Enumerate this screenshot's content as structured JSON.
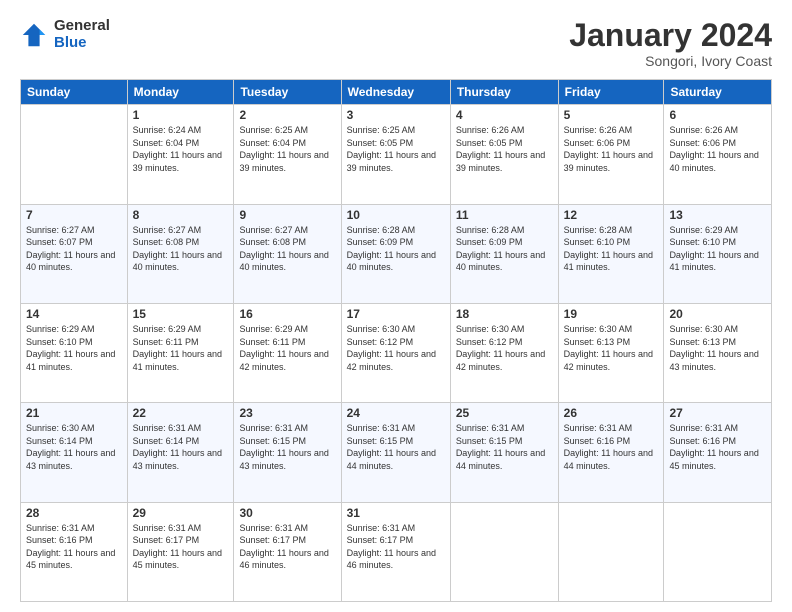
{
  "logo": {
    "general": "General",
    "blue": "Blue"
  },
  "header": {
    "title": "January 2024",
    "subtitle": "Songori, Ivory Coast"
  },
  "columns": [
    "Sunday",
    "Monday",
    "Tuesday",
    "Wednesday",
    "Thursday",
    "Friday",
    "Saturday"
  ],
  "weeks": [
    [
      {
        "day": "",
        "sunrise": "",
        "sunset": "",
        "daylight": ""
      },
      {
        "day": "1",
        "sunrise": "Sunrise: 6:24 AM",
        "sunset": "Sunset: 6:04 PM",
        "daylight": "Daylight: 11 hours and 39 minutes."
      },
      {
        "day": "2",
        "sunrise": "Sunrise: 6:25 AM",
        "sunset": "Sunset: 6:04 PM",
        "daylight": "Daylight: 11 hours and 39 minutes."
      },
      {
        "day": "3",
        "sunrise": "Sunrise: 6:25 AM",
        "sunset": "Sunset: 6:05 PM",
        "daylight": "Daylight: 11 hours and 39 minutes."
      },
      {
        "day": "4",
        "sunrise": "Sunrise: 6:26 AM",
        "sunset": "Sunset: 6:05 PM",
        "daylight": "Daylight: 11 hours and 39 minutes."
      },
      {
        "day": "5",
        "sunrise": "Sunrise: 6:26 AM",
        "sunset": "Sunset: 6:06 PM",
        "daylight": "Daylight: 11 hours and 39 minutes."
      },
      {
        "day": "6",
        "sunrise": "Sunrise: 6:26 AM",
        "sunset": "Sunset: 6:06 PM",
        "daylight": "Daylight: 11 hours and 40 minutes."
      }
    ],
    [
      {
        "day": "7",
        "sunrise": "Sunrise: 6:27 AM",
        "sunset": "Sunset: 6:07 PM",
        "daylight": "Daylight: 11 hours and 40 minutes."
      },
      {
        "day": "8",
        "sunrise": "Sunrise: 6:27 AM",
        "sunset": "Sunset: 6:08 PM",
        "daylight": "Daylight: 11 hours and 40 minutes."
      },
      {
        "day": "9",
        "sunrise": "Sunrise: 6:27 AM",
        "sunset": "Sunset: 6:08 PM",
        "daylight": "Daylight: 11 hours and 40 minutes."
      },
      {
        "day": "10",
        "sunrise": "Sunrise: 6:28 AM",
        "sunset": "Sunset: 6:09 PM",
        "daylight": "Daylight: 11 hours and 40 minutes."
      },
      {
        "day": "11",
        "sunrise": "Sunrise: 6:28 AM",
        "sunset": "Sunset: 6:09 PM",
        "daylight": "Daylight: 11 hours and 40 minutes."
      },
      {
        "day": "12",
        "sunrise": "Sunrise: 6:28 AM",
        "sunset": "Sunset: 6:10 PM",
        "daylight": "Daylight: 11 hours and 41 minutes."
      },
      {
        "day": "13",
        "sunrise": "Sunrise: 6:29 AM",
        "sunset": "Sunset: 6:10 PM",
        "daylight": "Daylight: 11 hours and 41 minutes."
      }
    ],
    [
      {
        "day": "14",
        "sunrise": "Sunrise: 6:29 AM",
        "sunset": "Sunset: 6:10 PM",
        "daylight": "Daylight: 11 hours and 41 minutes."
      },
      {
        "day": "15",
        "sunrise": "Sunrise: 6:29 AM",
        "sunset": "Sunset: 6:11 PM",
        "daylight": "Daylight: 11 hours and 41 minutes."
      },
      {
        "day": "16",
        "sunrise": "Sunrise: 6:29 AM",
        "sunset": "Sunset: 6:11 PM",
        "daylight": "Daylight: 11 hours and 42 minutes."
      },
      {
        "day": "17",
        "sunrise": "Sunrise: 6:30 AM",
        "sunset": "Sunset: 6:12 PM",
        "daylight": "Daylight: 11 hours and 42 minutes."
      },
      {
        "day": "18",
        "sunrise": "Sunrise: 6:30 AM",
        "sunset": "Sunset: 6:12 PM",
        "daylight": "Daylight: 11 hours and 42 minutes."
      },
      {
        "day": "19",
        "sunrise": "Sunrise: 6:30 AM",
        "sunset": "Sunset: 6:13 PM",
        "daylight": "Daylight: 11 hours and 42 minutes."
      },
      {
        "day": "20",
        "sunrise": "Sunrise: 6:30 AM",
        "sunset": "Sunset: 6:13 PM",
        "daylight": "Daylight: 11 hours and 43 minutes."
      }
    ],
    [
      {
        "day": "21",
        "sunrise": "Sunrise: 6:30 AM",
        "sunset": "Sunset: 6:14 PM",
        "daylight": "Daylight: 11 hours and 43 minutes."
      },
      {
        "day": "22",
        "sunrise": "Sunrise: 6:31 AM",
        "sunset": "Sunset: 6:14 PM",
        "daylight": "Daylight: 11 hours and 43 minutes."
      },
      {
        "day": "23",
        "sunrise": "Sunrise: 6:31 AM",
        "sunset": "Sunset: 6:15 PM",
        "daylight": "Daylight: 11 hours and 43 minutes."
      },
      {
        "day": "24",
        "sunrise": "Sunrise: 6:31 AM",
        "sunset": "Sunset: 6:15 PM",
        "daylight": "Daylight: 11 hours and 44 minutes."
      },
      {
        "day": "25",
        "sunrise": "Sunrise: 6:31 AM",
        "sunset": "Sunset: 6:15 PM",
        "daylight": "Daylight: 11 hours and 44 minutes."
      },
      {
        "day": "26",
        "sunrise": "Sunrise: 6:31 AM",
        "sunset": "Sunset: 6:16 PM",
        "daylight": "Daylight: 11 hours and 44 minutes."
      },
      {
        "day": "27",
        "sunrise": "Sunrise: 6:31 AM",
        "sunset": "Sunset: 6:16 PM",
        "daylight": "Daylight: 11 hours and 45 minutes."
      }
    ],
    [
      {
        "day": "28",
        "sunrise": "Sunrise: 6:31 AM",
        "sunset": "Sunset: 6:16 PM",
        "daylight": "Daylight: 11 hours and 45 minutes."
      },
      {
        "day": "29",
        "sunrise": "Sunrise: 6:31 AM",
        "sunset": "Sunset: 6:17 PM",
        "daylight": "Daylight: 11 hours and 45 minutes."
      },
      {
        "day": "30",
        "sunrise": "Sunrise: 6:31 AM",
        "sunset": "Sunset: 6:17 PM",
        "daylight": "Daylight: 11 hours and 46 minutes."
      },
      {
        "day": "31",
        "sunrise": "Sunrise: 6:31 AM",
        "sunset": "Sunset: 6:17 PM",
        "daylight": "Daylight: 11 hours and 46 minutes."
      },
      {
        "day": "",
        "sunrise": "",
        "sunset": "",
        "daylight": ""
      },
      {
        "day": "",
        "sunrise": "",
        "sunset": "",
        "daylight": ""
      },
      {
        "day": "",
        "sunrise": "",
        "sunset": "",
        "daylight": ""
      }
    ]
  ]
}
